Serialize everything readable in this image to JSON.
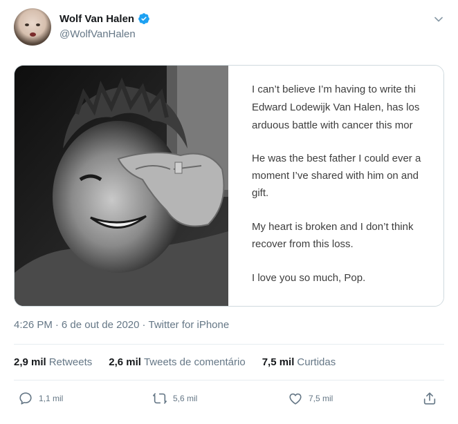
{
  "author": {
    "display_name": "Wolf Van Halen",
    "handle": "@WolfVanHalen",
    "verified": true
  },
  "note": {
    "lines": [
      "I can’t believe I’m having to write thi",
      "Edward Lodewijk Van Halen, has los",
      "arduous battle with cancer this mor",
      "He was the best father I could ever a",
      "moment I’ve shared with him on and",
      "gift.",
      "My heart is broken and I don’t think",
      "recover from this loss.",
      "I love you so much, Pop."
    ]
  },
  "meta": {
    "time": "4:26 PM",
    "sep1": "·",
    "date": "6 de out de 2020",
    "sep2": "·",
    "source": "Twitter for iPhone"
  },
  "stats": [
    {
      "value": "2,9 mil",
      "label": "Retweets"
    },
    {
      "value": "2,6 mil",
      "label": "Tweets de comentário"
    },
    {
      "value": "7,5 mil",
      "label": "Curtidas"
    }
  ],
  "actions": {
    "reply_count": "1,1 mil",
    "retweet_count": "5,6 mil",
    "like_count": "7,5 mil"
  },
  "icons": [
    "verified-badge-icon",
    "chevron-down-icon",
    "reply-icon",
    "retweet-icon",
    "like-icon",
    "share-icon"
  ],
  "colors": {
    "accent": "#1da1f2",
    "secondary_text": "#657786",
    "primary_text": "#14171a"
  }
}
